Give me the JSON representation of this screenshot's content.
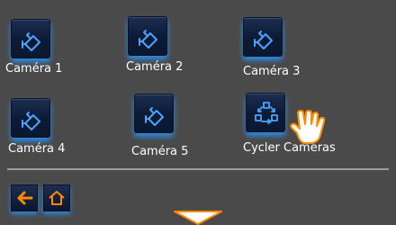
{
  "cameras": [
    {
      "label": "Caméra 1"
    },
    {
      "label": "Caméra 2"
    },
    {
      "label": "Caméra 3"
    },
    {
      "label": "Caméra 4"
    },
    {
      "label": "Caméra 5"
    }
  ],
  "cycle": {
    "label": "Cycler Caméras"
  },
  "icons": {
    "camera": "camera-icon",
    "cycle": "cycle-cameras-icon",
    "back": "back-arrow-icon",
    "home": "home-icon",
    "scroll": "scroll-down-icon",
    "pointer": "hand-pointer-icon"
  },
  "colors": {
    "background": "#4a4a4a",
    "icon_blue": "#4aa3ff",
    "accent_orange": "#ff8a00"
  }
}
